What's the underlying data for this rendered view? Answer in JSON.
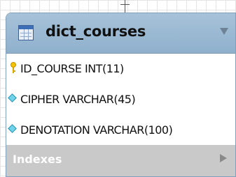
{
  "table": {
    "title": "dict_courses",
    "icon": "table-icon",
    "collapse_icon": "triangle-down-icon",
    "columns": [
      {
        "text": "ID_COURSE INT(11)",
        "icon": "primary-key-icon"
      },
      {
        "text": "CIPHER VARCHAR(45)",
        "icon": "column-diamond-icon"
      },
      {
        "text": "DENOTATION VARCHAR(100)",
        "icon": "column-diamond-icon"
      }
    ],
    "indexes": {
      "label": "Indexes",
      "icon": "triangle-right-icon"
    }
  },
  "colors": {
    "header": "#9bbbd6",
    "border": "#7f9fba",
    "indexes_bg": "#c9c9c9",
    "key": "#f3c500",
    "diamond": "#6fd3ea"
  }
}
